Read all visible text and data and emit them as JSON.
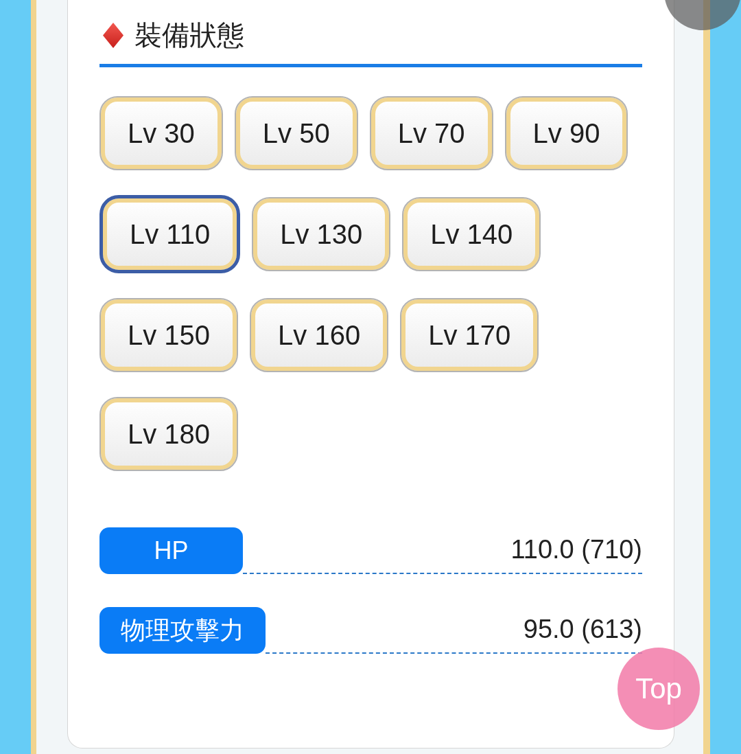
{
  "section": {
    "title": "裝備狀態"
  },
  "levels": [
    {
      "label": "Lv 30",
      "selected": false
    },
    {
      "label": "Lv 50",
      "selected": false
    },
    {
      "label": "Lv 70",
      "selected": false
    },
    {
      "label": "Lv 90",
      "selected": false
    },
    {
      "label": "Lv 110",
      "selected": true
    },
    {
      "label": "Lv 130",
      "selected": false
    },
    {
      "label": "Lv 140",
      "selected": false
    },
    {
      "label": "Lv 150",
      "selected": false
    },
    {
      "label": "Lv 160",
      "selected": false
    },
    {
      "label": "Lv 170",
      "selected": false
    },
    {
      "label": "Lv 180",
      "selected": false
    }
  ],
  "stats": [
    {
      "label": "HP",
      "value": "110.0 (710)"
    },
    {
      "label": "物理攻擊力",
      "value": "95.0 (613)"
    }
  ],
  "top_button": {
    "label": "Top"
  }
}
